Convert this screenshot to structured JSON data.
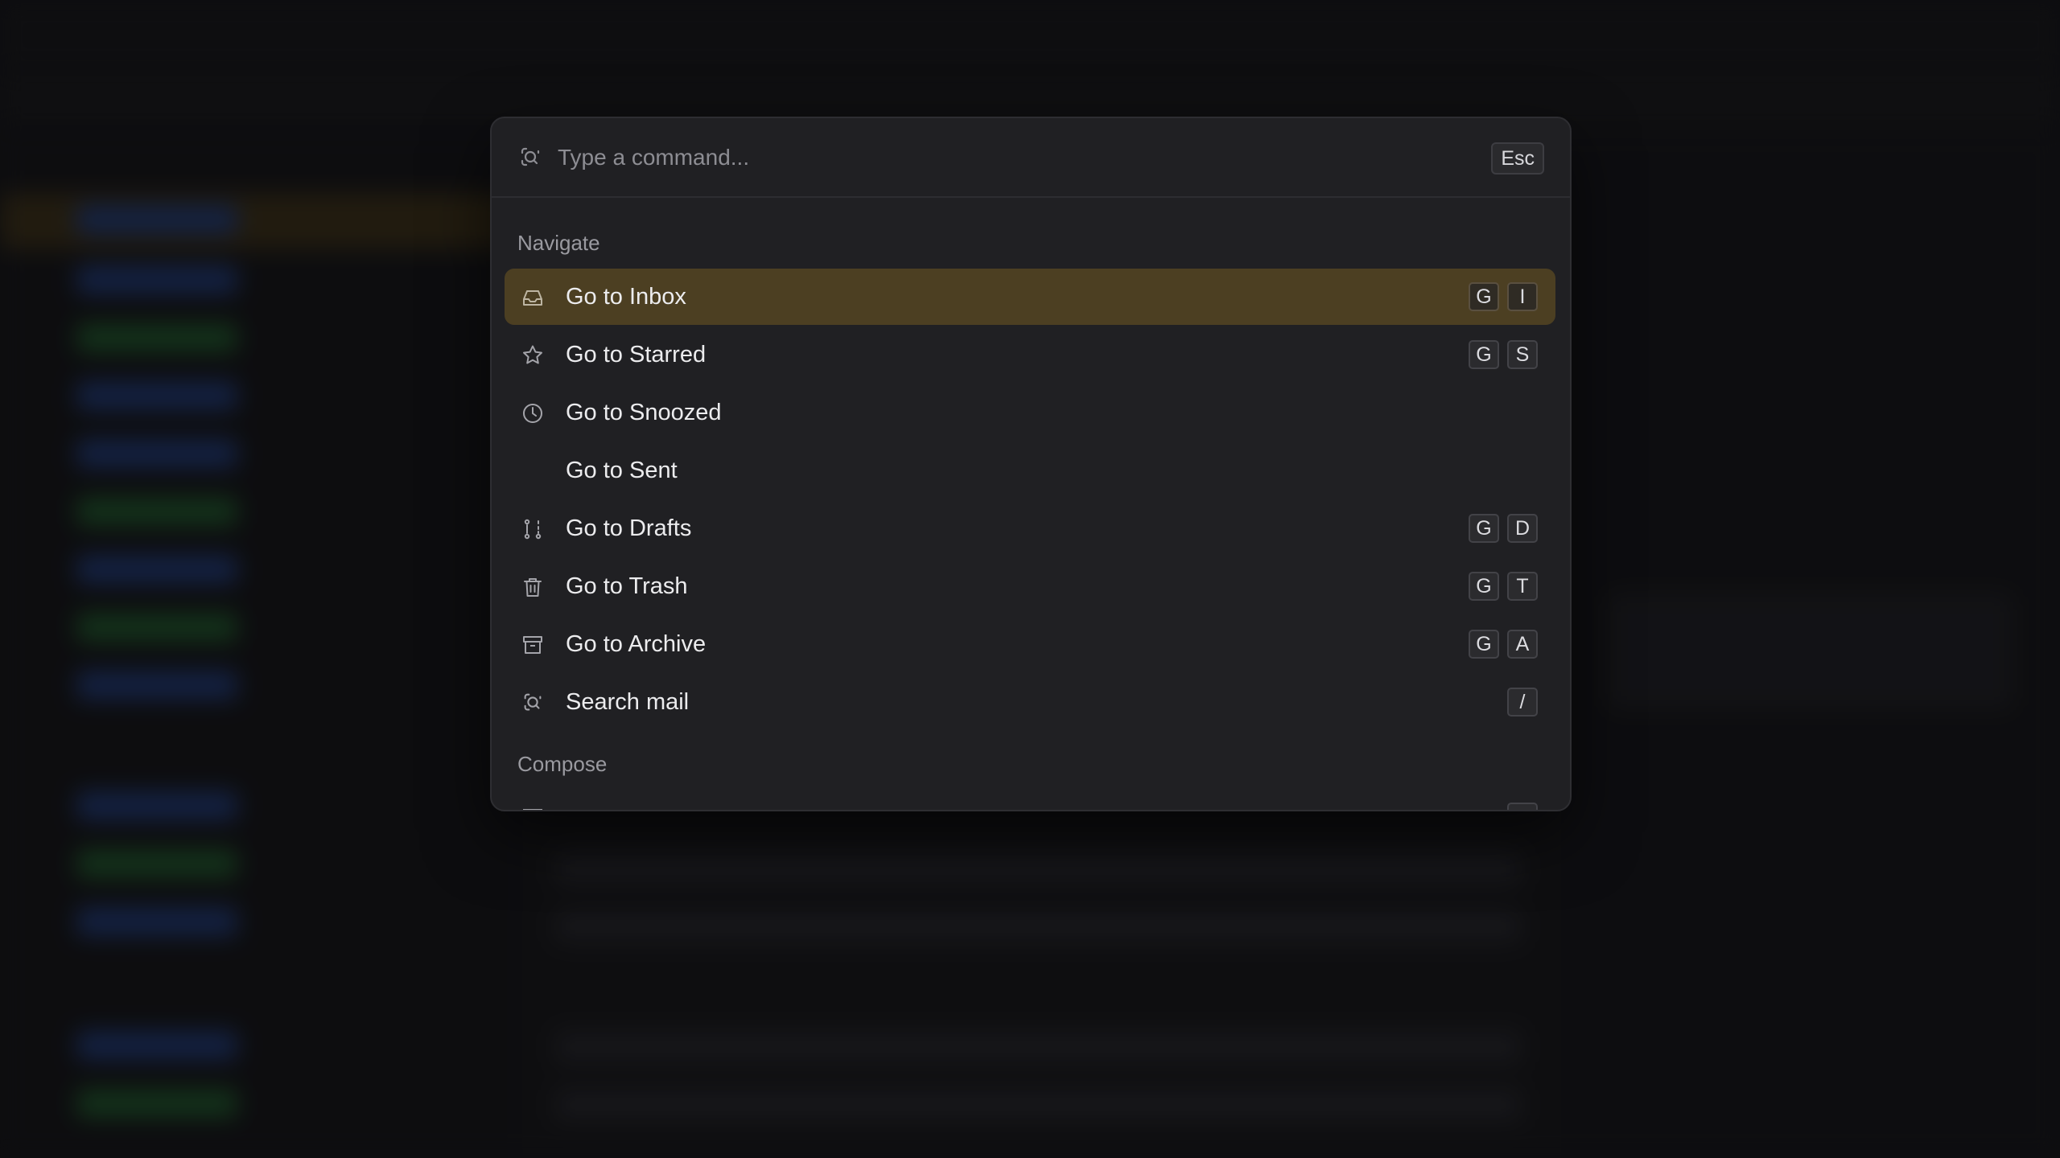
{
  "palette": {
    "search": {
      "placeholder": "Type a command...",
      "value": ""
    },
    "esc_key": "Esc",
    "sections": {
      "navigate": "Navigate",
      "compose": "Compose"
    },
    "commands": [
      {
        "label": "Go to Inbox",
        "icon": "inbox-icon",
        "keys": [
          "G",
          "I"
        ],
        "active": true
      },
      {
        "label": "Go to Starred",
        "icon": "star-icon",
        "keys": [
          "G",
          "S"
        ]
      },
      {
        "label": "Go to Snoozed",
        "icon": "clock-icon",
        "keys": []
      },
      {
        "label": "Go to Sent",
        "icon": "",
        "keys": []
      },
      {
        "label": "Go to Drafts",
        "icon": "drafts-icon",
        "keys": [
          "G",
          "D"
        ]
      },
      {
        "label": "Go to Trash",
        "icon": "trash-icon",
        "keys": [
          "G",
          "T"
        ]
      },
      {
        "label": "Go to Archive",
        "icon": "archive-icon",
        "keys": [
          "G",
          "A"
        ]
      },
      {
        "label": "Search mail",
        "icon": "search-icon",
        "keys": [
          "/"
        ]
      }
    ],
    "colors": {
      "active_row": "#4c3f22",
      "panel": "#202023"
    }
  }
}
